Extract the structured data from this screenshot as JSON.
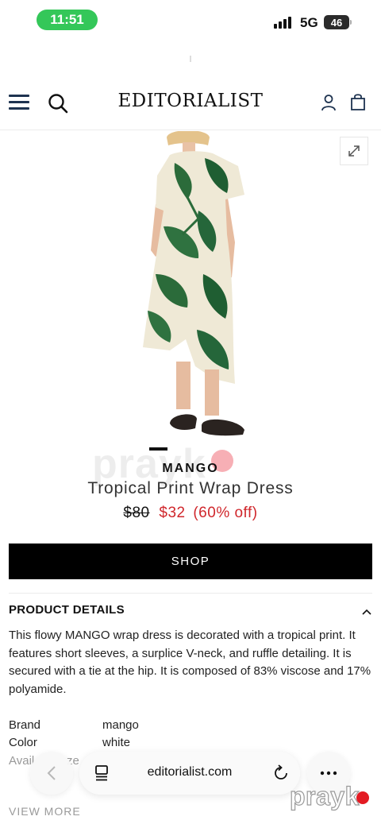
{
  "status_bar": {
    "time": "11:51",
    "network": "5G",
    "battery": "46",
    "time_pill_color": "#34c759"
  },
  "header": {
    "logo_text": "EDITORIALIST",
    "icons": [
      "menu-icon",
      "search-icon",
      "user-icon",
      "bag-icon"
    ]
  },
  "product": {
    "brand": "MANGO",
    "title": "Tropical Print Wrap Dress",
    "original_price": "$80",
    "sale_price": "$32",
    "discount": "(60% off)",
    "sale_color": "#d0272c",
    "image_description_icon": "dress-photo"
  },
  "shop_button": {
    "label": "SHOP"
  },
  "details": {
    "heading": "PRODUCT DETAILS",
    "description": "This flowy MANGO wrap dress is decorated with a tropical print. It features short sleeves, a surplice V-neck, and ruffle detailing. It is secured with a tie at the hip. It is composed of 83% viscose and 17% polyamide.",
    "specs": [
      {
        "label": "Brand",
        "value": "mango"
      },
      {
        "label": "Color",
        "value": "white"
      },
      {
        "label": "Avail",
        "value": "ze"
      }
    ],
    "view_more": "VIEW MORE"
  },
  "browser": {
    "address": "editorialist.com"
  },
  "watermark": {
    "text": "prayk",
    "faded_text": "prayk"
  }
}
